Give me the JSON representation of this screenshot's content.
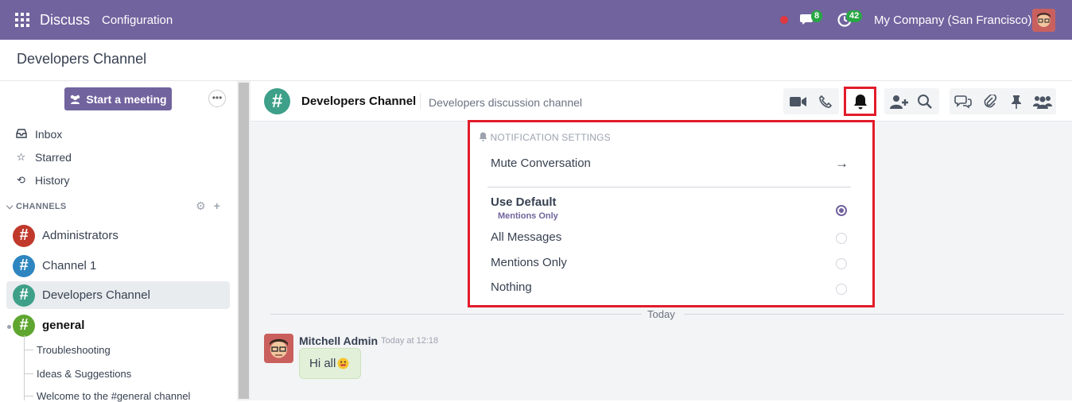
{
  "topbar": {
    "app_name": "Discuss",
    "menu_configuration": "Configuration",
    "messages_count": "8",
    "activities_count": "42",
    "company": "My Company (San Francisco)"
  },
  "breadcrumb": "Developers Channel",
  "sidebar": {
    "start_meeting": "Start a meeting",
    "mailboxes": [
      {
        "label": "Inbox",
        "icon": "inbox-icon"
      },
      {
        "label": "Starred",
        "icon": "star-icon"
      },
      {
        "label": "History",
        "icon": "history-icon"
      }
    ],
    "channels_header": "CHANNELS",
    "channels": [
      {
        "label": "Administrators",
        "color": "#c0392b"
      },
      {
        "label": "Channel 1",
        "color": "#2e86c1"
      },
      {
        "label": "Developers Channel",
        "color": "#3ea089"
      },
      {
        "label": "general",
        "color": "#5fa630"
      }
    ],
    "subchannels": [
      "Troubleshooting",
      "Ideas & Suggestions",
      "Welcome to the #general channel"
    ]
  },
  "thread": {
    "name": "Developers Channel",
    "description": "Developers discussion channel"
  },
  "notification_panel": {
    "title": "NOTIFICATION SETTINGS",
    "mute": "Mute Conversation",
    "use_default": "Use Default",
    "use_default_sub": "Mentions Only",
    "options": [
      "All Messages",
      "Mentions Only",
      "Nothing"
    ],
    "selected": "Use Default"
  },
  "messages": {
    "separator": "Today",
    "author": "Mitchell Admin",
    "time": "Today at 12:18",
    "body": "Hi all"
  },
  "colors": {
    "brand": "#71639e",
    "highlight": "#e21b2a",
    "badge": "#28a745"
  }
}
